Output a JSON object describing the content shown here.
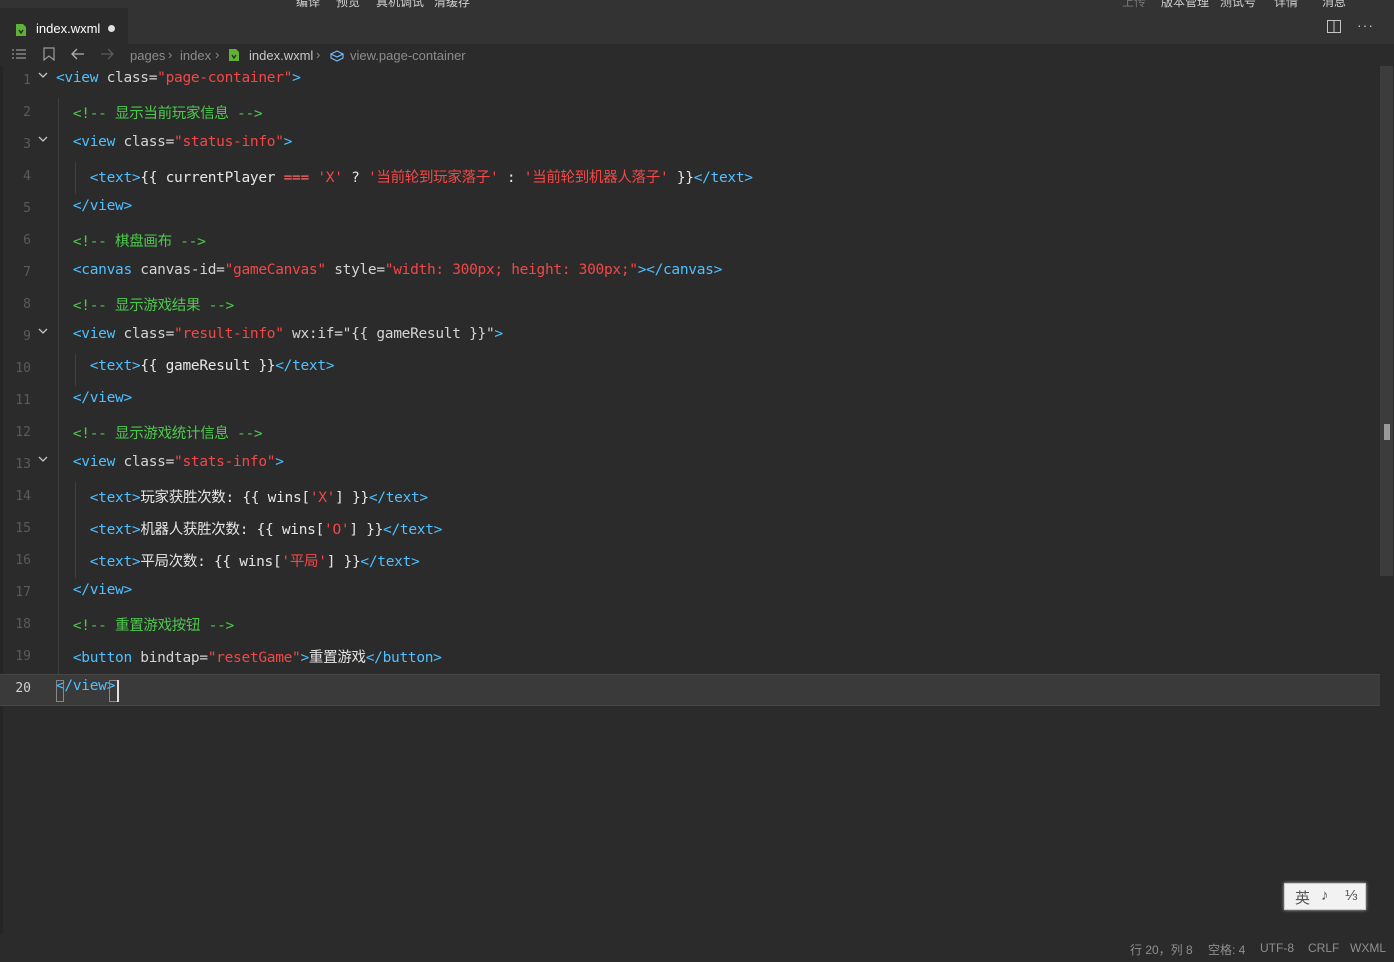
{
  "top_menu": {
    "items": [
      "编译",
      "预览",
      "真机调试",
      "清缓存"
    ],
    "right_items": [
      "上传",
      "版本管理",
      "测试号",
      "详情",
      "消息"
    ]
  },
  "tab": {
    "filename": "index.wxml"
  },
  "breadcrumb": {
    "items": [
      "pages",
      "index",
      "index.wxml",
      "view.page-container"
    ]
  },
  "editor": {
    "line_numbers": [
      "1",
      "2",
      "3",
      "4",
      "5",
      "6",
      "7",
      "8",
      "9",
      "10",
      "11",
      "12",
      "13",
      "14",
      "15",
      "16",
      "17",
      "18",
      "19",
      "20"
    ],
    "active_line": 20,
    "lines": [
      [
        {
          "c": "tag",
          "t": "<view"
        },
        {
          "c": "at",
          "t": " class="
        },
        {
          "c": "str",
          "t": "\"page-container\""
        },
        {
          "c": "tag",
          "t": ">"
        }
      ],
      [
        {
          "c": "cm",
          "t": "  <!-- 显示当前玩家信息 -->"
        }
      ],
      [
        {
          "c": "tag",
          "t": "  <view"
        },
        {
          "c": "at",
          "t": " class="
        },
        {
          "c": "str",
          "t": "\"status-info\""
        },
        {
          "c": "tag",
          "t": ">"
        }
      ],
      [
        {
          "c": "tag",
          "t": "    <text>"
        },
        {
          "c": "tx",
          "t": "{{ currentPlayer "
        },
        {
          "c": "sy",
          "t": "==="
        },
        {
          "c": "tx",
          "t": " "
        },
        {
          "c": "str",
          "t": "'X'"
        },
        {
          "c": "tx",
          "t": " ? "
        },
        {
          "c": "str",
          "t": "'当前轮到玩家落子'"
        },
        {
          "c": "tx",
          "t": " : "
        },
        {
          "c": "str",
          "t": "'当前轮到机器人落子'"
        },
        {
          "c": "tx",
          "t": " }}"
        },
        {
          "c": "tag",
          "t": "</text>"
        }
      ],
      [
        {
          "c": "tag",
          "t": "  </view>"
        }
      ],
      [
        {
          "c": "cm",
          "t": "  <!-- 棋盘画布 -->"
        }
      ],
      [
        {
          "c": "tag",
          "t": "  <canvas"
        },
        {
          "c": "at",
          "t": " canvas-id="
        },
        {
          "c": "str",
          "t": "\"gameCanvas\""
        },
        {
          "c": "at",
          "t": " style="
        },
        {
          "c": "str",
          "t": "\"width: 300px; height: 300px;\""
        },
        {
          "c": "tag",
          "t": "></canvas>"
        }
      ],
      [
        {
          "c": "cm",
          "t": "  <!-- 显示游戏结果 -->"
        }
      ],
      [
        {
          "c": "tag",
          "t": "  <view"
        },
        {
          "c": "at",
          "t": " class="
        },
        {
          "c": "str",
          "t": "\"result-info\""
        },
        {
          "c": "at",
          "t": " wx:if=\"{{ gameResult }}\""
        },
        {
          "c": "tag",
          "t": ">"
        }
      ],
      [
        {
          "c": "tag",
          "t": "    <text>"
        },
        {
          "c": "tx",
          "t": "{{ gameResult }}"
        },
        {
          "c": "tag",
          "t": "</text>"
        }
      ],
      [
        {
          "c": "tag",
          "t": "  </view>"
        }
      ],
      [
        {
          "c": "cm",
          "t": "  <!-- 显示游戏统计信息 -->"
        }
      ],
      [
        {
          "c": "tag",
          "t": "  <view"
        },
        {
          "c": "at",
          "t": " class="
        },
        {
          "c": "str",
          "t": "\"stats-info\""
        },
        {
          "c": "tag",
          "t": ">"
        }
      ],
      [
        {
          "c": "tag",
          "t": "    <text>"
        },
        {
          "c": "tx",
          "t": "玩家获胜次数: {{ wins["
        },
        {
          "c": "str",
          "t": "'X'"
        },
        {
          "c": "tx",
          "t": "] }}"
        },
        {
          "c": "tag",
          "t": "</text>"
        }
      ],
      [
        {
          "c": "tag",
          "t": "    <text>"
        },
        {
          "c": "tx",
          "t": "机器人获胜次数: {{ wins["
        },
        {
          "c": "str",
          "t": "'O'"
        },
        {
          "c": "tx",
          "t": "] }}"
        },
        {
          "c": "tag",
          "t": "</text>"
        }
      ],
      [
        {
          "c": "tag",
          "t": "    <text>"
        },
        {
          "c": "tx",
          "t": "平局次数: {{ wins["
        },
        {
          "c": "str",
          "t": "'平局'"
        },
        {
          "c": "tx",
          "t": "] }}"
        },
        {
          "c": "tag",
          "t": "</text>"
        }
      ],
      [
        {
          "c": "tag",
          "t": "  </view>"
        }
      ],
      [
        {
          "c": "cm",
          "t": "  <!-- 重置游戏按钮 -->"
        }
      ],
      [
        {
          "c": "tag",
          "t": "  <button"
        },
        {
          "c": "at",
          "t": " bindtap="
        },
        {
          "c": "str",
          "t": "\"resetGame\""
        },
        {
          "c": "tag",
          "t": ">"
        },
        {
          "c": "tx",
          "t": "重置游戏"
        },
        {
          "c": "tag",
          "t": "</button>"
        }
      ],
      [
        {
          "c": "tag",
          "t": "</view>"
        }
      ]
    ]
  },
  "ime": {
    "mode": "英",
    "punct": "♪",
    "width": "⅓"
  },
  "status_bar": {
    "position": "行 20，列 8",
    "indent": "空格: 4",
    "encoding": "UTF-8",
    "eol": "CRLF",
    "language": "WXML"
  }
}
